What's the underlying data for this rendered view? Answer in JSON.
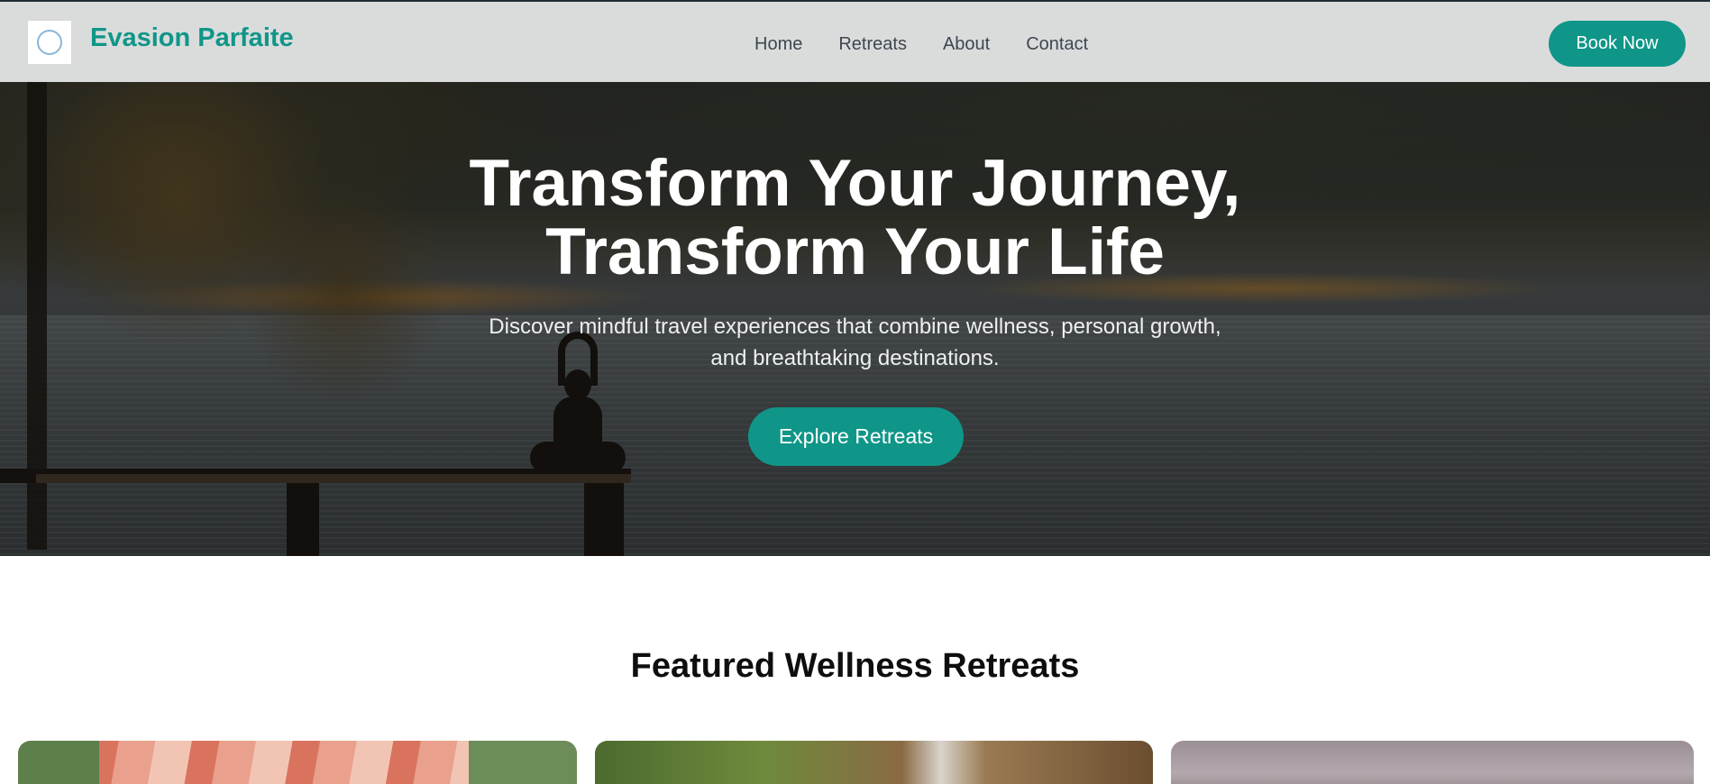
{
  "nav": {
    "brand": "Evasion Parfaite",
    "logo_text": "Evasion Parfaite",
    "links": [
      "Home",
      "Retreats",
      "About",
      "Contact"
    ],
    "cta": "Book Now"
  },
  "hero": {
    "title_line1": "Transform Your Journey,",
    "title_line2": "Transform Your Life",
    "subtitle_line1": "Discover mindful travel experiences that combine wellness, personal growth,",
    "subtitle_line2": "and breathtaking destinations.",
    "cta": "Explore Retreats"
  },
  "featured": {
    "title": "Featured Wellness Retreats",
    "cards": [
      {
        "image": "canopy-garden-photo"
      },
      {
        "image": "tropical-pavilion-photo"
      },
      {
        "image": "misty-mountain-photo"
      }
    ]
  },
  "colors": {
    "accent": "#0f9688",
    "nav_bg": "#e2e4e4",
    "nav_text": "#3e4750"
  }
}
